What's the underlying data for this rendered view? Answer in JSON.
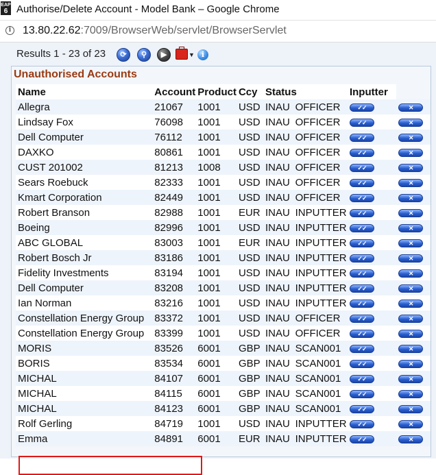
{
  "window": {
    "icon_text_top": "EAP",
    "icon_text_big": "6",
    "title": "Authorise/Delete Account - Model Bank – Google Chrome"
  },
  "address_bar": {
    "host": "13.80.22.62",
    "path": ":7009/BrowserWeb/servlet/BrowserServlet"
  },
  "toolbar": {
    "results_text": "Results 1 - 23 of 23",
    "icons": [
      "refresh-icon",
      "search-icon",
      "next-icon",
      "toolbox-icon",
      "help-icon"
    ]
  },
  "panel": {
    "title": "Unauthorised Accounts",
    "columns": [
      "Name",
      "Account",
      "Product",
      "Ccy",
      "Status",
      "Inputter"
    ],
    "action_icons": {
      "authorise": "checkmark-icon",
      "delete": "cross-icon"
    },
    "rows": [
      {
        "name": "Allegra",
        "account": "21067",
        "product": "1001",
        "ccy": "USD",
        "inau": "INAU",
        "status": "OFFICER"
      },
      {
        "name": "Lindsay Fox",
        "account": "76098",
        "product": "1001",
        "ccy": "USD",
        "inau": "INAU",
        "status": "OFFICER"
      },
      {
        "name": "Dell Computer",
        "account": "76112",
        "product": "1001",
        "ccy": "USD",
        "inau": "INAU",
        "status": "OFFICER"
      },
      {
        "name": "DAXKO",
        "account": "80861",
        "product": "1001",
        "ccy": "USD",
        "inau": "INAU",
        "status": "OFFICER"
      },
      {
        "name": "CUST 201002",
        "account": "81213",
        "product": "1008",
        "ccy": "USD",
        "inau": "INAU",
        "status": "OFFICER"
      },
      {
        "name": "Sears Roebuck",
        "account": "82333",
        "product": "1001",
        "ccy": "USD",
        "inau": "INAU",
        "status": "OFFICER"
      },
      {
        "name": "Kmart Corporation",
        "account": "82449",
        "product": "1001",
        "ccy": "USD",
        "inau": "INAU",
        "status": "OFFICER"
      },
      {
        "name": "Robert Branson",
        "account": "82988",
        "product": "1001",
        "ccy": "EUR",
        "inau": "INAU",
        "status": "INPUTTER"
      },
      {
        "name": "Boeing",
        "account": "82996",
        "product": "1001",
        "ccy": "USD",
        "inau": "INAU",
        "status": "INPUTTER"
      },
      {
        "name": "ABC GLOBAL",
        "account": "83003",
        "product": "1001",
        "ccy": "EUR",
        "inau": "INAU",
        "status": "INPUTTER"
      },
      {
        "name": "Robert Bosch Jr",
        "account": "83186",
        "product": "1001",
        "ccy": "USD",
        "inau": "INAU",
        "status": "INPUTTER"
      },
      {
        "name": "Fidelity Investments",
        "account": "83194",
        "product": "1001",
        "ccy": "USD",
        "inau": "INAU",
        "status": "INPUTTER"
      },
      {
        "name": "Dell Computer",
        "account": "83208",
        "product": "1001",
        "ccy": "USD",
        "inau": "INAU",
        "status": "INPUTTER"
      },
      {
        "name": "Ian Norman",
        "account": "83216",
        "product": "1001",
        "ccy": "USD",
        "inau": "INAU",
        "status": "INPUTTER"
      },
      {
        "name": "Constellation Energy Group",
        "account": "83372",
        "product": "1001",
        "ccy": "USD",
        "inau": "INAU",
        "status": "OFFICER"
      },
      {
        "name": "Constellation Energy Group",
        "account": "83399",
        "product": "1001",
        "ccy": "USD",
        "inau": "INAU",
        "status": "OFFICER"
      },
      {
        "name": "MORIS",
        "account": "83526",
        "product": "6001",
        "ccy": "GBP",
        "inau": "INAU",
        "status": "SCAN001"
      },
      {
        "name": "BORIS",
        "account": "83534",
        "product": "6001",
        "ccy": "GBP",
        "inau": "INAU",
        "status": "SCAN001"
      },
      {
        "name": "MICHAL",
        "account": "84107",
        "product": "6001",
        "ccy": "GBP",
        "inau": "INAU",
        "status": "SCAN001"
      },
      {
        "name": "MICHAL",
        "account": "84115",
        "product": "6001",
        "ccy": "GBP",
        "inau": "INAU",
        "status": "SCAN001"
      },
      {
        "name": "MICHAL",
        "account": "84123",
        "product": "6001",
        "ccy": "GBP",
        "inau": "INAU",
        "status": "SCAN001"
      },
      {
        "name": "Rolf Gerling",
        "account": "84719",
        "product": "1001",
        "ccy": "USD",
        "inau": "INAU",
        "status": "INPUTTER"
      },
      {
        "name": "Emma",
        "account": "84891",
        "product": "6001",
        "ccy": "EUR",
        "inau": "INAU",
        "status": "INPUTTER"
      }
    ]
  },
  "colors": {
    "panel_title": "#9a3a12",
    "highlight_box": "#e01818",
    "button_blue": "#2a5fcf"
  }
}
